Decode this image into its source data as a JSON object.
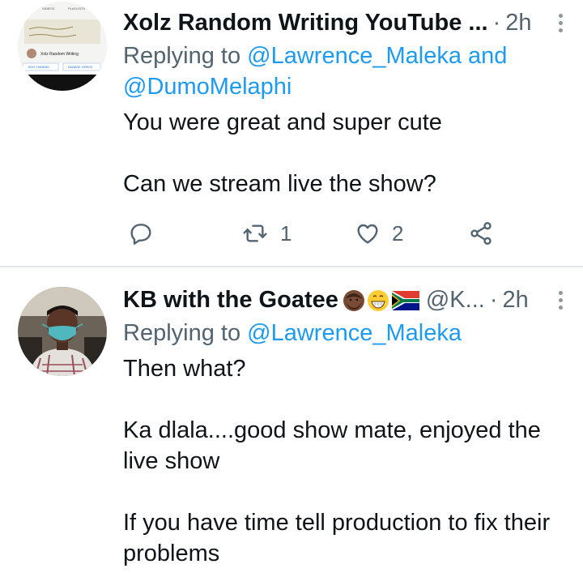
{
  "tweets": [
    {
      "author": "Xolz Random Writing YouTube ...",
      "time": "2h",
      "replying_prefix": "Replying to",
      "mention1": "@Lawrence_Maleka",
      "joiner": "and",
      "mention2": "@DumoMelaphi",
      "lines": [
        "You were great and super cute",
        "Can we stream live the show?"
      ],
      "retweets": "1",
      "likes": "2",
      "avatar": {
        "tab1": "VIDEOS",
        "tab2": "PLAYLISTS",
        "channel_name": "Xolz Random Writing",
        "edit_button": "EDIT CHANNEL",
        "manage_button": "MANAGE VIDEOS"
      }
    },
    {
      "author": "KB with the Goatee",
      "handle": "@K...",
      "time": "2h",
      "replying_prefix": "Replying to",
      "mention1": "@Lawrence_Maleka",
      "lines": [
        "Then what?",
        "Ka dlala....good show mate, enjoyed the live show",
        "If you have time tell production to fix their problems"
      ]
    }
  ],
  "colors": {
    "link": "#1d9bf0",
    "secondary": "#536471",
    "text": "#0f1419",
    "divider": "#e6e9ec"
  },
  "icons": [
    "reply-icon",
    "retweet-icon",
    "like-icon",
    "share-icon",
    "more-icon"
  ]
}
